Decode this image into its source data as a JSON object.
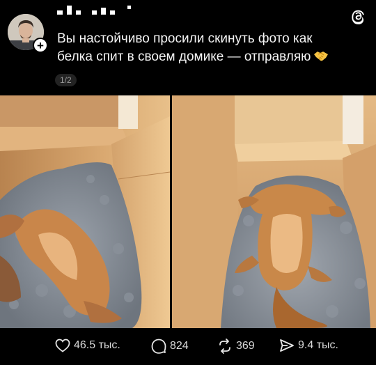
{
  "post": {
    "caption_line1": "Вы настойчиво просили скинуть фото как",
    "caption_line2": "белка спит в своем домике — отправляю",
    "caption_emoji": "🤝",
    "image_counter": "1/2"
  },
  "actions": {
    "likes": "46.5 тыс.",
    "replies": "824",
    "reposts": "369",
    "shares": "9.4 тыс."
  },
  "icons": [
    "threads-logo-icon",
    "heart-icon",
    "reply-icon",
    "repost-icon",
    "share-icon",
    "plus-icon",
    "handshake-emoji-icon"
  ]
}
